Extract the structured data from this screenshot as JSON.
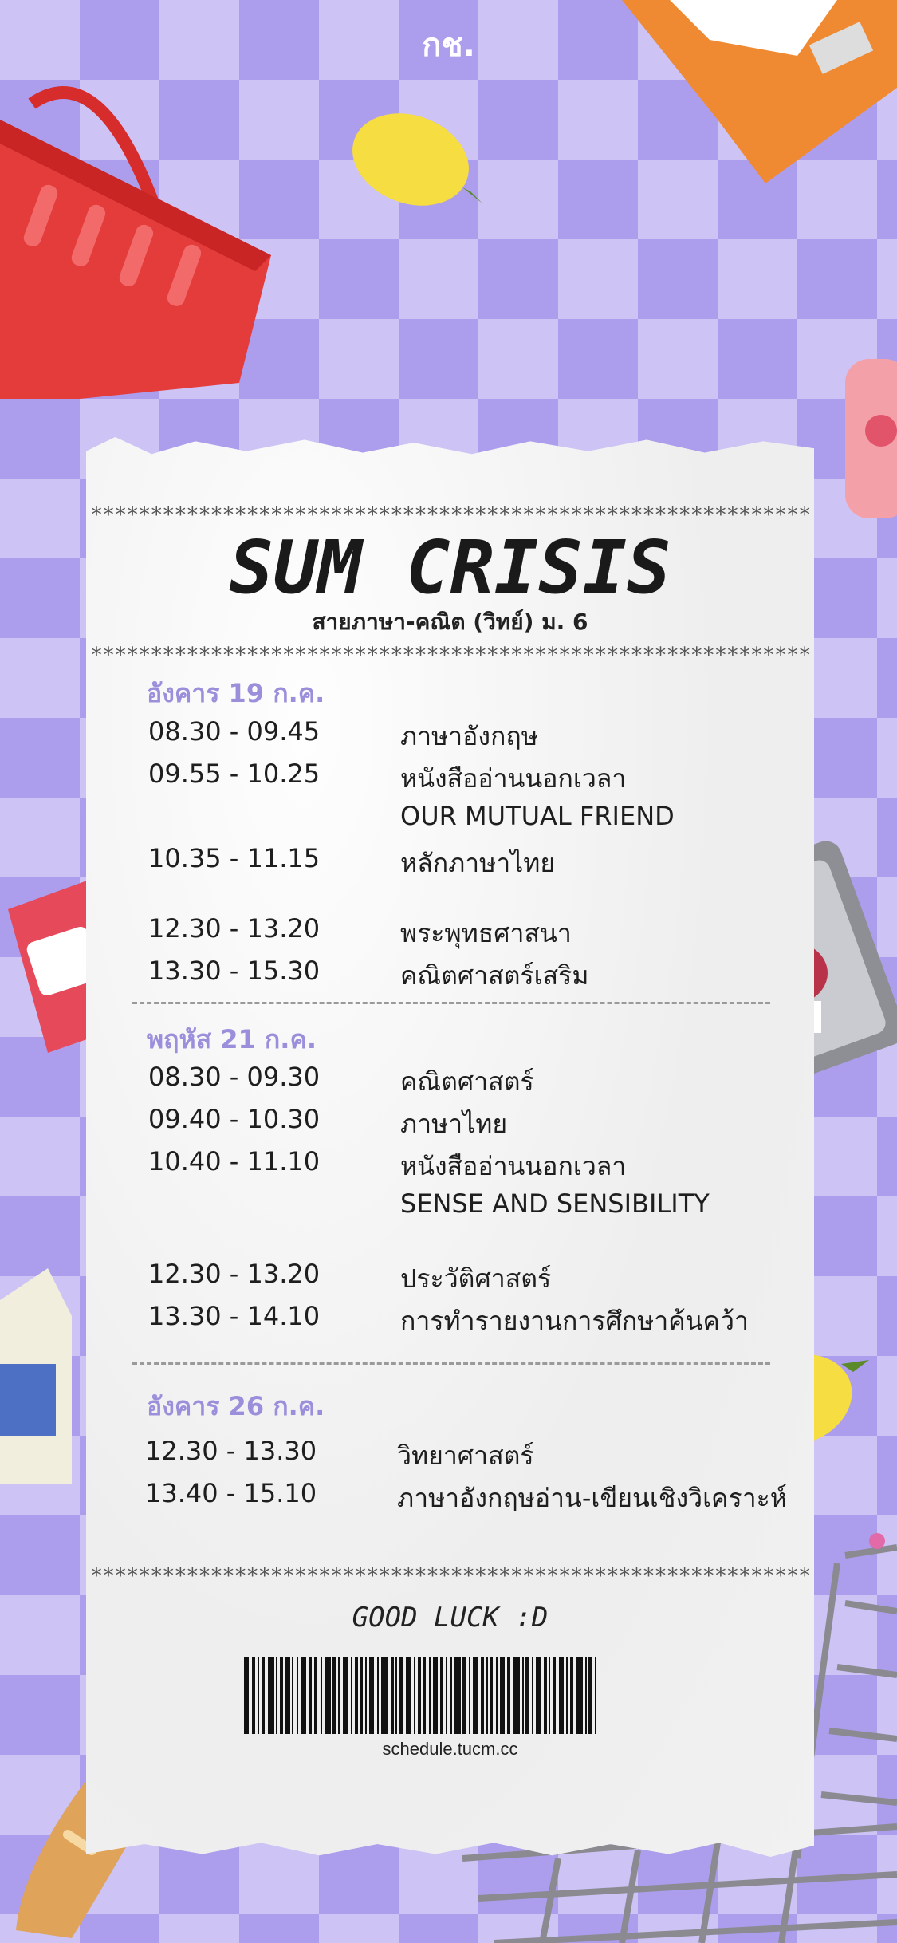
{
  "brand": "กช.",
  "receipt": {
    "stars": "************************************************************",
    "title": "SUM CRISIS",
    "subtitle": "สายภาษา-คณิต (วิทย์) ม. 6",
    "days": [
      {
        "label": "อังคาร 19 ก.ค.",
        "rows": [
          {
            "time": "08.30 - 09.45",
            "subject": "ภาษาอังกฤษ"
          },
          {
            "time": "09.55 - 10.25",
            "subject": "หนังสืออ่านนอกเวลา"
          },
          {
            "time": "",
            "subject": "OUR MUTUAL FRIEND"
          },
          {
            "time": "10.35 - 11.15",
            "subject": "หลักภาษาไทย"
          },
          {
            "time": "12.30 - 13.20",
            "subject": "พระพุทธศาสนา"
          },
          {
            "time": "13.30 - 15.30",
            "subject": "คณิตศาสตร์เสริม"
          }
        ]
      },
      {
        "label": "พฤหัส 21 ก.ค.",
        "rows": [
          {
            "time": "08.30 - 09.30",
            "subject": "คณิตศาสตร์"
          },
          {
            "time": "09.40 - 10.30",
            "subject": "ภาษาไทย"
          },
          {
            "time": "10.40 - 11.10",
            "subject": "หนังสืออ่านนอกเวลา"
          },
          {
            "time": "",
            "subject": "SENSE AND SENSIBILITY"
          },
          {
            "time": "12.30 - 13.20",
            "subject": "ประวัติศาสตร์"
          },
          {
            "time": "13.30 - 14.10",
            "subject": "การทำรายงานการศึกษาค้นคว้า"
          }
        ]
      },
      {
        "label": "อังคาร 26 ก.ค.",
        "rows": [
          {
            "time": "12.30 - 13.30",
            "subject": "วิทยาศาสตร์"
          },
          {
            "time": "13.40 - 15.10",
            "subject": "ภาษาอังกฤษอ่าน-เขียนเชิงวิเคราะห์"
          }
        ]
      }
    ],
    "footer": "GOOD LUCK :D",
    "barcode_text": "schedule.tucm.cc"
  },
  "decor": {
    "basket_icon": "shopping-basket-icon",
    "chips_label": "potato chips",
    "colors": {
      "accent": "#9b8fdc",
      "check_dark": "#ad9ded",
      "check_light": "#cdc3f5"
    }
  }
}
